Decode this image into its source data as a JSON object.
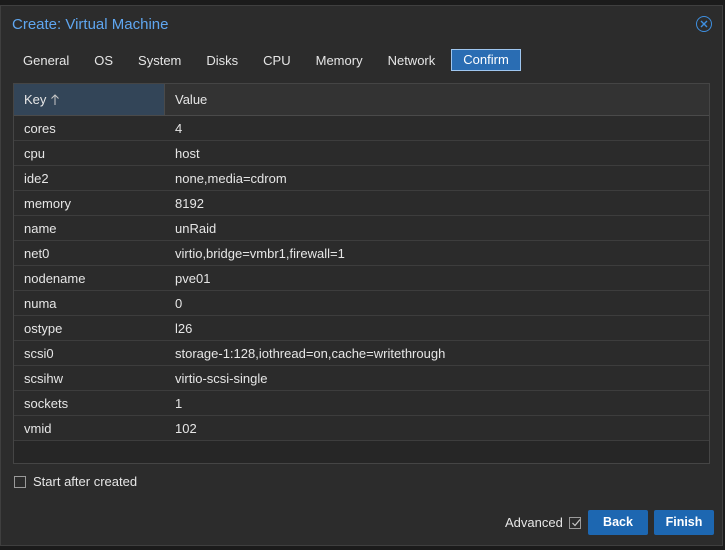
{
  "window": {
    "title": "Create: Virtual Machine"
  },
  "tabs": [
    {
      "label": "General"
    },
    {
      "label": "OS"
    },
    {
      "label": "System"
    },
    {
      "label": "Disks"
    },
    {
      "label": "CPU"
    },
    {
      "label": "Memory"
    },
    {
      "label": "Network"
    },
    {
      "label": "Confirm",
      "active": true
    }
  ],
  "grid": {
    "columns": {
      "key": "Key",
      "value": "Value"
    },
    "sort_icon": "arrow-up-icon",
    "rows": [
      {
        "key": "cores",
        "value": "4"
      },
      {
        "key": "cpu",
        "value": "host"
      },
      {
        "key": "ide2",
        "value": "none,media=cdrom"
      },
      {
        "key": "memory",
        "value": "8192"
      },
      {
        "key": "name",
        "value": "unRaid"
      },
      {
        "key": "net0",
        "value": "virtio,bridge=vmbr1,firewall=1"
      },
      {
        "key": "nodename",
        "value": "pve01"
      },
      {
        "key": "numa",
        "value": "0"
      },
      {
        "key": "ostype",
        "value": "l26"
      },
      {
        "key": "scsi0",
        "value": "storage-1:128,iothread=on,cache=writethrough"
      },
      {
        "key": "scsihw",
        "value": "virtio-scsi-single"
      },
      {
        "key": "sockets",
        "value": "1"
      },
      {
        "key": "vmid",
        "value": "102"
      }
    ]
  },
  "footer": {
    "start_after_created": {
      "label": "Start after created",
      "checked": false
    },
    "advanced": {
      "label": "Advanced",
      "checked": true
    },
    "back_label": "Back",
    "finish_label": "Finish"
  },
  "colors": {
    "title": "#5fa6f0",
    "accent": "#1d67b1",
    "active_tab": "#2a6db3"
  }
}
